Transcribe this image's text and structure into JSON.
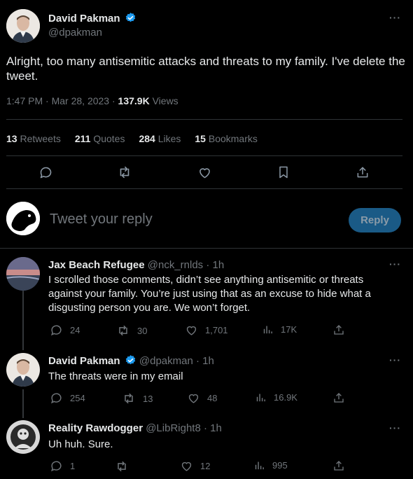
{
  "main_tweet": {
    "author_name": "David Pakman",
    "author_handle": "@dpakman",
    "text": "Alright, too many antisemitic attacks and threats to my family. I've delete the tweet.",
    "time": "1:47 PM",
    "date": "Mar 28, 2023",
    "views_count": "137.9K",
    "views_label": "Views",
    "retweets_count": "13",
    "retweets_label": "Retweets",
    "quotes_count": "211",
    "quotes_label": "Quotes",
    "likes_count": "284",
    "likes_label": "Likes",
    "bookmarks_count": "15",
    "bookmarks_label": "Bookmarks"
  },
  "composer": {
    "placeholder": "Tweet your reply",
    "reply_button": "Reply"
  },
  "replies": [
    {
      "name": "Jax Beach Refugee",
      "handle": "@nck_rnlds",
      "time": "· 1h",
      "text": "I scrolled those comments, didn’t see anything antisemitic or threats against your family.  You’re just using that as an excuse to hide what a disgusting person you are.  We won’t forget.",
      "replies": "24",
      "retweets": "30",
      "likes": "1,701",
      "views": "17K"
    },
    {
      "name": "David Pakman",
      "handle": "@dpakman",
      "time": "· 1h",
      "text": "The threats were in my email",
      "replies": "254",
      "retweets": "13",
      "likes": "48",
      "views": "16.9K"
    },
    {
      "name": "Reality Rawdogger",
      "handle": "@LibRight8",
      "time": "· 1h",
      "text": "Uh huh. Sure.",
      "replies": "1",
      "retweets": "",
      "likes": "12",
      "views": "995"
    }
  ],
  "icons": {
    "verified": "verified-badge-icon",
    "more": "more-dots-icon"
  },
  "colors": {
    "background": "#000000",
    "text": "#e7e9ea",
    "muted": "#71767b",
    "accent": "#1d9bf0",
    "reply_button_bg": "#1a5a86"
  }
}
